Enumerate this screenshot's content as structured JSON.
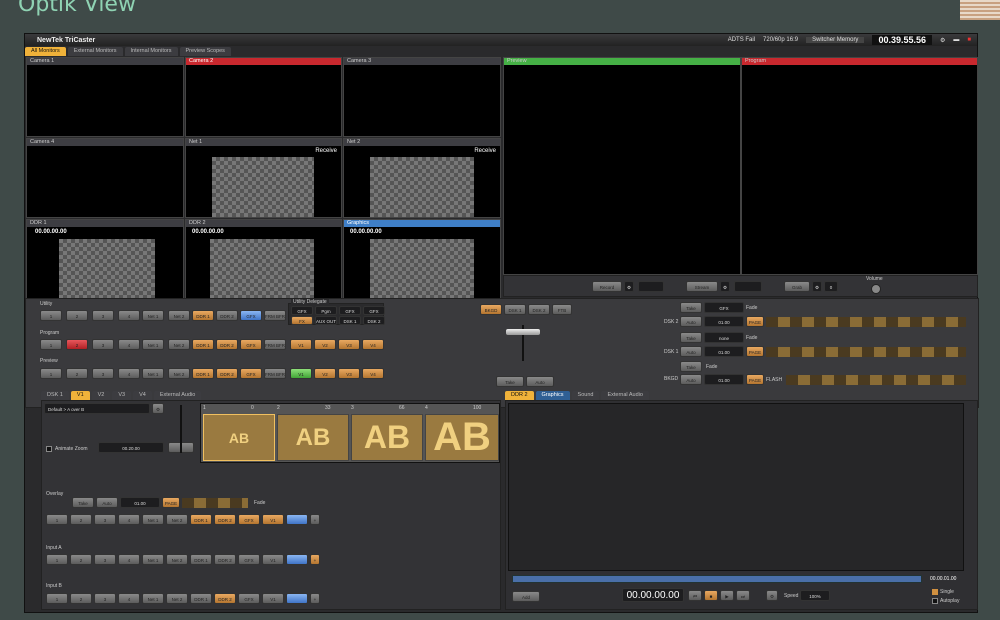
{
  "bezel": {
    "title": "Optik View"
  },
  "app": {
    "title": "NewTek TriCaster",
    "ants": "ADTS Fail",
    "format": "720/60p 16:9",
    "switcher_memory": "Switcher Memory",
    "clock": "00.39.55.56"
  },
  "monitor_tabs": [
    "All Monitors",
    "External Monitors",
    "Internal Monitors",
    "Preview Scopes"
  ],
  "monitors": {
    "camera1": "Camera 1",
    "camera2": "Camera 2",
    "camera3": "Camera 3",
    "camera4": "Camera 4",
    "net1": "Net 1",
    "net2": "Net 2",
    "ddr1": "DDR 1",
    "ddr2": "DDR 2",
    "graphics": "Graphics",
    "receive": "Receive",
    "tc": "00.00.00.00"
  },
  "preview": {
    "label": "Preview"
  },
  "program": {
    "label": "Program"
  },
  "record": {
    "record": "Record",
    "stream": "Stream",
    "grab": "Grab",
    "grab_count": "0",
    "volume": "Volume"
  },
  "row_labels": {
    "utility": "Utility",
    "program": "Program",
    "preview": "Preview"
  },
  "buttons": {
    "b1": "1",
    "b2": "2",
    "b3": "3",
    "b4": "4",
    "net1": "Net 1",
    "net2": "Net 2",
    "ddr1": "DDR 1",
    "ddr2": "DDR 2",
    "gfx": "GFX",
    "frm": "FRM BFR",
    "v1": "V1",
    "v2": "V2",
    "v3": "V3",
    "v4": "V4"
  },
  "utility_delegate": {
    "title": "Utility Delegate",
    "top": [
      "GFX",
      "Pgm",
      "GFX",
      "GFX"
    ],
    "bottom": [
      "FX",
      "AUX OUT",
      "DSK 1",
      "DSK 2"
    ]
  },
  "trans": {
    "delegate": [
      "BKGD",
      "DSK 1",
      "DSK 2",
      "FTB"
    ],
    "take": "Take",
    "auto": "Auto"
  },
  "dsk": {
    "dsk2": "DSK 2",
    "dsk1": "DSK 1",
    "bkgd": "BKGD",
    "take": "Take",
    "auto": "Auto",
    "gfx": "GFX",
    "none": "none",
    "fade": "Fade",
    "speed": "01.00",
    "page": "PAGE",
    "flash": "FLASH"
  },
  "lower_tabs": [
    "DSK 1",
    "V1",
    "V2",
    "V3",
    "V4",
    "External Audio"
  ],
  "right_tabs": [
    "DDR 2",
    "Graphics",
    "Sound",
    "External Audio"
  ],
  "effects": {
    "preset": "Default > A over B",
    "animate_zoom": "Animate Zoom",
    "zoom_time": "00.20.00",
    "slots": [
      "1",
      "2",
      "3",
      "4"
    ],
    "slot_vals": [
      "0",
      "33",
      "66",
      "100"
    ]
  },
  "overlay": {
    "label": "Overlay",
    "take": "Take",
    "auto": "Auto",
    "speed": "01.00",
    "page": "PAGE",
    "fade": "Fade"
  },
  "inputs": {
    "input_a": "Input A",
    "input_b": "Input B"
  },
  "ddr_player": {
    "add": "Add",
    "tc": "00.00.00.00",
    "speed_label": "Speed",
    "speed": "100%",
    "end_tc": "00.00.01.00",
    "single": "Single",
    "autoplay": "Autoplay"
  }
}
